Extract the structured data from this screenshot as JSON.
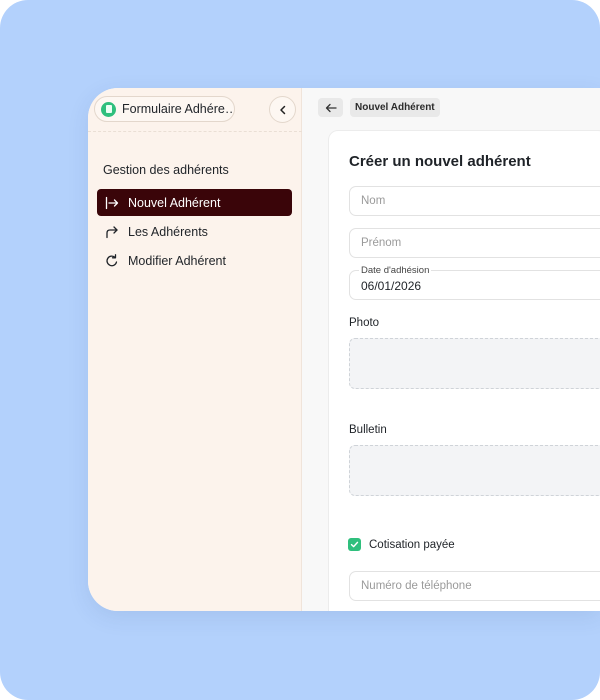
{
  "sidebar": {
    "app_name": "Formulaire Adhére…",
    "group_label": "Gestion des adhérents",
    "items": [
      {
        "label": "Nouvel Adhérent",
        "icon": "arrow-in-icon",
        "active": true
      },
      {
        "label": "Les Adhérents",
        "icon": "arrow-turn-right-icon",
        "active": false
      },
      {
        "label": "Modifier Adhérent",
        "icon": "refresh-icon",
        "active": false
      }
    ]
  },
  "header": {
    "breadcrumb": "Nouvel Adhérent"
  },
  "form": {
    "title": "Créer un nouvel adhérent",
    "nom_placeholder": "Nom",
    "prenom_placeholder": "Prénom",
    "date_label": "Date d'adhésion",
    "date_value": "06/01/2026",
    "photo_label": "Photo",
    "bulletin_label": "Bulletin",
    "cotisation_label": "Cotisation payée",
    "cotisation_checked": true,
    "phone_placeholder": "Numéro de téléphone"
  },
  "colors": {
    "backdrop": "#b3d1fc",
    "sidebar_bg": "#fcf3ec",
    "active_item": "#3a0509",
    "accent_green": "#2fbf7d"
  }
}
